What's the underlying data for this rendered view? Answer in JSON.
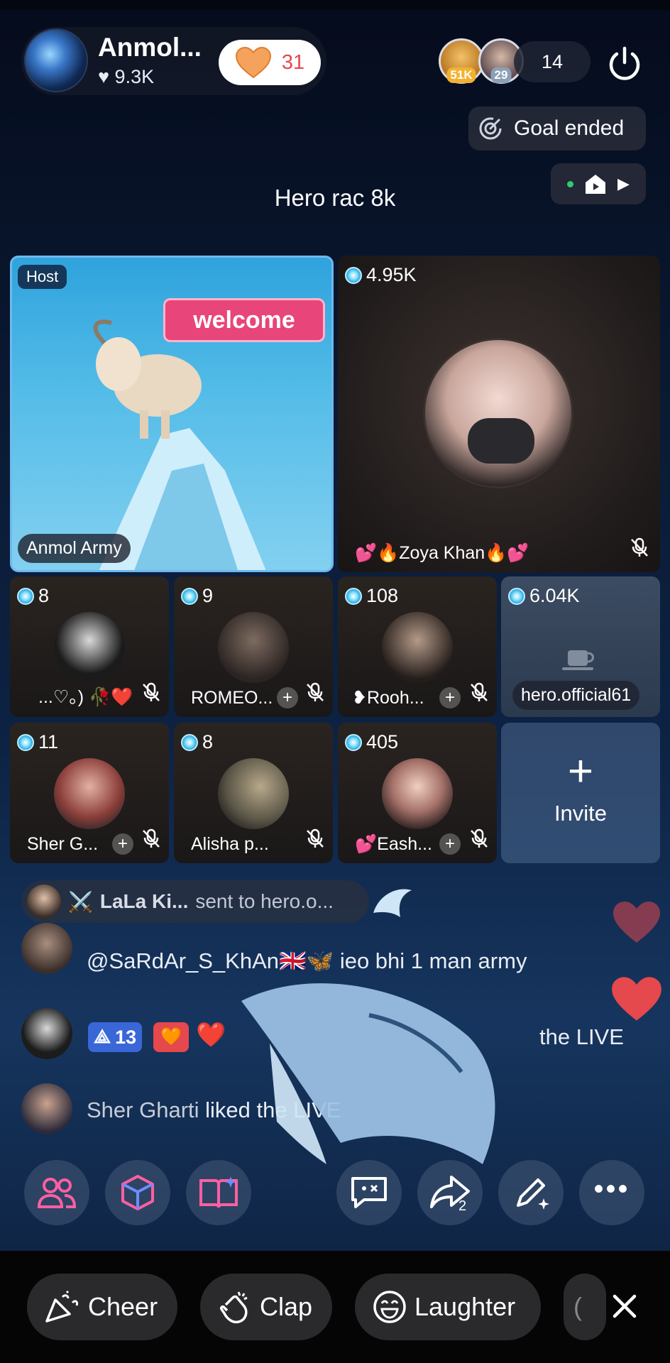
{
  "header": {
    "host_name": "Anmol...",
    "host_likes": "9.3K",
    "follow_count": "31",
    "viewer_badges": [
      "51K",
      "29"
    ],
    "viewer_count": "14"
  },
  "goal": {
    "label": "Goal ended"
  },
  "room_title": "Hero rac 8k",
  "host_tile": {
    "tag": "Host",
    "name": "Anmol Army",
    "effect_text": "welcome"
  },
  "guest_main": {
    "score": "4.95K",
    "name": "Zoya Khan"
  },
  "seats": [
    {
      "score": "8",
      "name": "...♡。)"
    },
    {
      "score": "9",
      "name": "ROMEO..."
    },
    {
      "score": "108",
      "name": "Rooh..."
    },
    {
      "score": "6.04K",
      "name": "hero.official61"
    },
    {
      "score": "11",
      "name": "Sher G..."
    },
    {
      "score": "8",
      "name": "Alisha p..."
    },
    {
      "score": "405",
      "name": "Eash..."
    }
  ],
  "invite": {
    "label": "Invite"
  },
  "chat": {
    "gift_banner": {
      "sender": "LaLa Ki...",
      "text": "sent to hero.o..."
    },
    "messages": [
      {
        "text": "@SaRdAr_S_KhAn🇬🇧🦋 ieo bhi 1 man army"
      },
      {
        "level": "13",
        "text": "the LIVE"
      },
      {
        "user": "Sher Gharti",
        "text": "liked the LIVE"
      }
    ]
  },
  "actions": {
    "share_count": "2"
  },
  "reactions": [
    "Cheer",
    "Clap",
    "Laughter"
  ],
  "colors": {
    "accent_pink": "#e8457a",
    "gem_blue": "#29a9e0",
    "live_green": "#2ecc71"
  }
}
